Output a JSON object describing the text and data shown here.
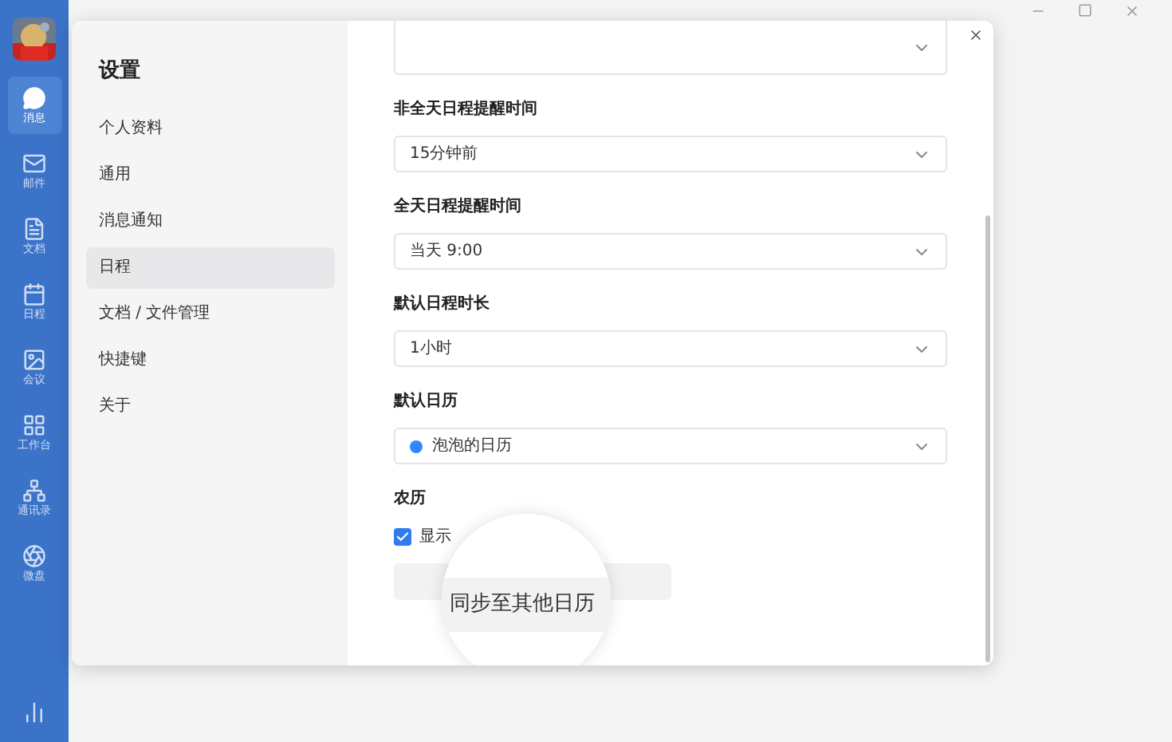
{
  "app_sidebar": {
    "items": [
      {
        "label": "消息",
        "kind": "chat",
        "selected": true
      },
      {
        "label": "邮件",
        "kind": "mail",
        "selected": false
      },
      {
        "label": "文档",
        "kind": "doc",
        "selected": false
      },
      {
        "label": "日程",
        "kind": "calendar",
        "selected": false
      },
      {
        "label": "会议",
        "kind": "meeting",
        "selected": false
      },
      {
        "label": "工作台",
        "kind": "grid",
        "selected": false
      },
      {
        "label": "通讯录",
        "kind": "contacts",
        "selected": false
      },
      {
        "label": "微盘",
        "kind": "disk",
        "selected": false
      }
    ]
  },
  "settings": {
    "title": "设置",
    "nav": [
      {
        "label": "个人资料",
        "selected": false
      },
      {
        "label": "通用",
        "selected": false
      },
      {
        "label": "消息通知",
        "selected": false
      },
      {
        "label": "日程",
        "selected": true
      },
      {
        "label": "文档 / 文件管理",
        "selected": false
      },
      {
        "label": "快捷键",
        "selected": false
      },
      {
        "label": "关于",
        "selected": false
      }
    ]
  },
  "top_select": {
    "kind": "select"
  },
  "sections": [
    {
      "label": "非全天日程提醒时间",
      "kind": "select",
      "value": "15分钟前"
    },
    {
      "label": "全天日程提醒时间",
      "kind": "select",
      "value": "当天 9:00"
    },
    {
      "label": "默认日程时长",
      "kind": "select",
      "value": "1小时"
    },
    {
      "label": "默认日历",
      "kind": "select",
      "value": "泡泡的日历",
      "color": "#2f88ff"
    },
    {
      "label": "农历",
      "kind": "checkbox",
      "checked": true,
      "text": "显示"
    }
  ],
  "magnifier": {
    "text": "同步至其他日历"
  }
}
